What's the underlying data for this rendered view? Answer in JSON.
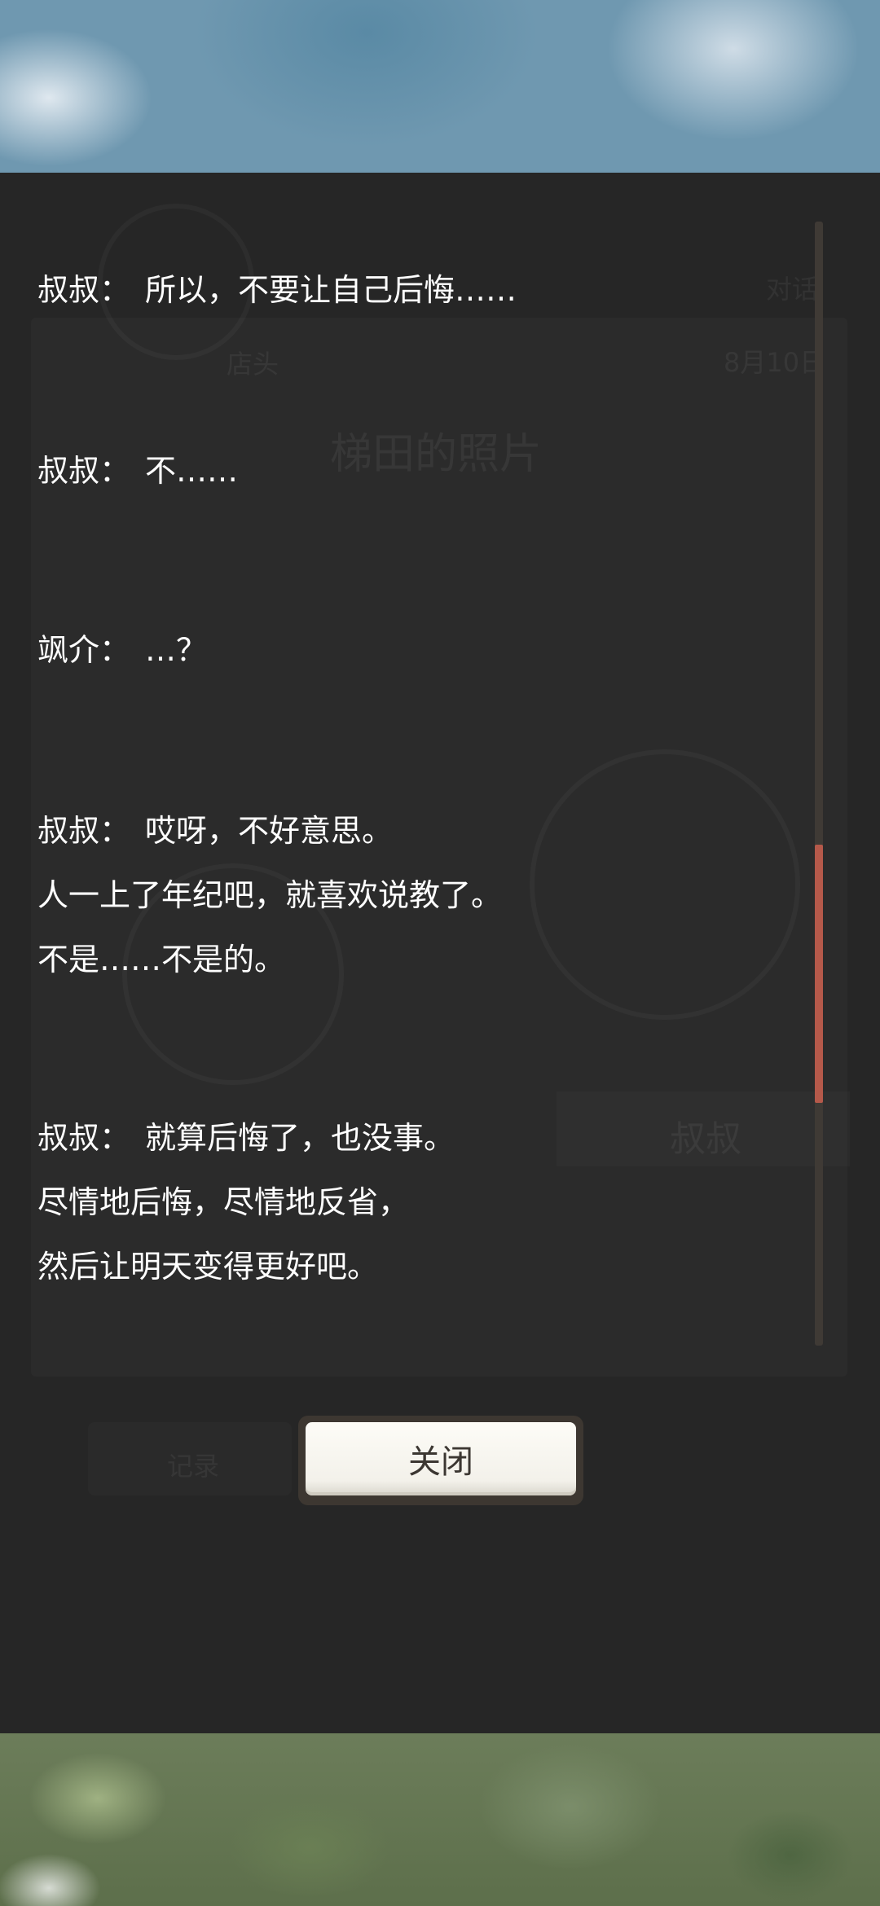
{
  "background": {
    "top_image": "sky-with-clouds",
    "bottom_image": "blurred-foliage"
  },
  "underlying_scene": {
    "tag": "对话",
    "place": "店头",
    "date": "8月10日",
    "title": "梯田的照片",
    "speaker": "叔叔",
    "log_button": "记录"
  },
  "log": {
    "entries": [
      {
        "speaker": "叔叔：",
        "lines": [
          "所以，不要让自己后悔……"
        ]
      },
      {
        "speaker": "叔叔：",
        "lines": [
          "不……"
        ]
      },
      {
        "speaker": "飒介：",
        "lines": [
          "…？"
        ]
      },
      {
        "speaker": "叔叔：",
        "lines": [
          "哎呀，不好意思。",
          "人一上了年纪吧，就喜欢说教了。",
          "不是……不是的。"
        ]
      },
      {
        "speaker": "叔叔：",
        "lines": [
          "就算后悔了，也没事。",
          "尽情地后悔，尽情地反省，",
          "然后让明天变得更好吧。"
        ]
      }
    ]
  },
  "scrollbar": {
    "thumb_position_fraction": 0.72,
    "thumb_size_fraction": 0.23,
    "track_color": "#3f3a35",
    "thumb_color": "#b5594a"
  },
  "buttons": {
    "close_label": "关闭"
  },
  "colors": {
    "overlay": "#262626",
    "text": "#ffffff",
    "button_text": "#3b3631"
  }
}
